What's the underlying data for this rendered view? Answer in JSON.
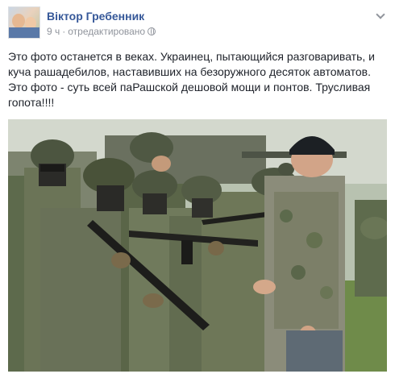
{
  "post": {
    "author": "Віктор Гребенник",
    "time": "9 ч",
    "separator": "·",
    "edited": "отредактировано",
    "text": "Это фото останется в веках. Украинец, пытающийся разговаривать, и\nкуча рашадебилов, наставивших на безоружного десяток автоматов.\nЭто фото - суть всей паРашской дешовой мощи и понтов. Трусливая\nгопота!!!!"
  },
  "icons": {
    "avatar": "avatar",
    "privacy": "globe-icon",
    "options": "chevron-down-icon"
  },
  "colors": {
    "author_link": "#365899",
    "meta_text": "#90949c",
    "body_text": "#1d2129"
  }
}
